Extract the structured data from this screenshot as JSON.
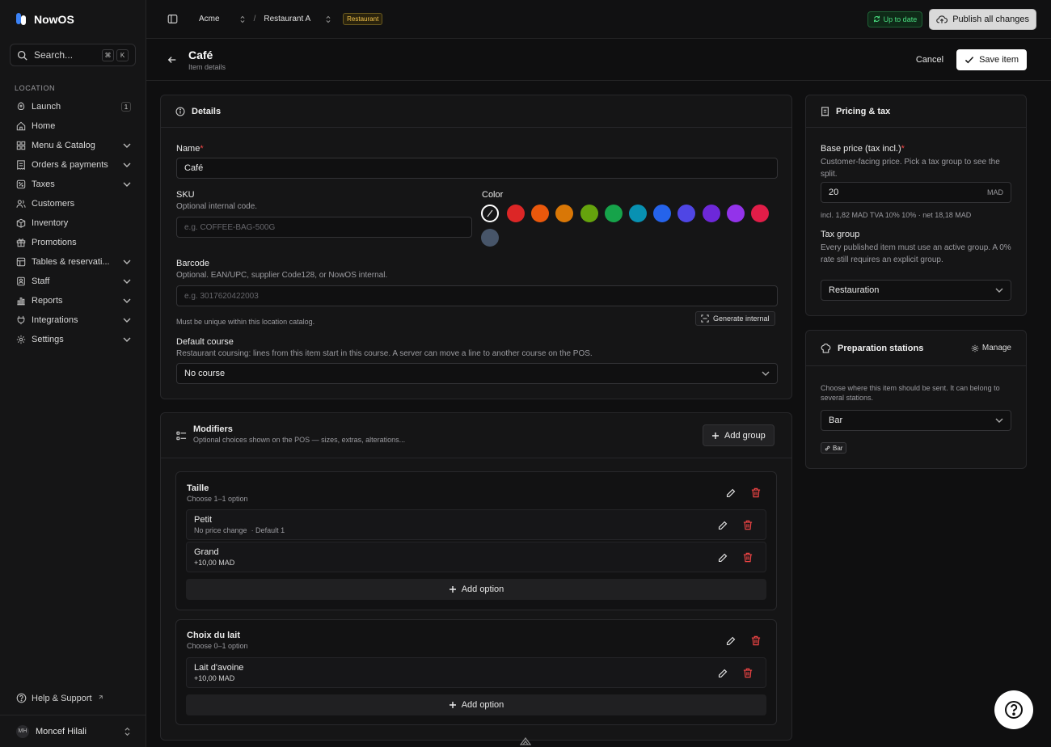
{
  "brand": {
    "name": "NowOS"
  },
  "search": {
    "placeholder": "Search...",
    "kbd1": "⌘",
    "kbd2": "K"
  },
  "sidebar": {
    "section": "LOCATION",
    "items": [
      {
        "label": "Launch",
        "count": "1",
        "icon": "rocket-icon"
      },
      {
        "label": "Home",
        "icon": "home-icon"
      },
      {
        "label": "Menu & Catalog",
        "icon": "grid-icon",
        "expand": true
      },
      {
        "label": "Orders & payments",
        "icon": "receipt-icon",
        "expand": true
      },
      {
        "label": "Taxes",
        "icon": "percent-icon",
        "expand": true
      },
      {
        "label": "Customers",
        "icon": "users-icon"
      },
      {
        "label": "Inventory",
        "icon": "box-icon"
      },
      {
        "label": "Promotions",
        "icon": "gift-icon"
      },
      {
        "label": "Tables & reservati...",
        "icon": "table-icon",
        "expand": true
      },
      {
        "label": "Staff",
        "icon": "staff-icon",
        "expand": true
      },
      {
        "label": "Reports",
        "icon": "chart-icon",
        "expand": true
      },
      {
        "label": "Integrations",
        "icon": "plug-icon",
        "expand": true
      },
      {
        "label": "Settings",
        "icon": "gear-icon",
        "expand": true
      }
    ],
    "help": "Help & Support",
    "user": {
      "initials": "MH",
      "name": "Moncef Hilali"
    }
  },
  "topbar": {
    "org": "Acme",
    "location": "Restaurant A",
    "tag": "Restaurant",
    "status": "Up to date",
    "publish": "Publish all changes"
  },
  "page": {
    "title": "Café",
    "subtitle": "Item details",
    "cancel": "Cancel",
    "save": "Save item"
  },
  "details": {
    "title": "Details",
    "name_label": "Name",
    "name_value": "Café",
    "sku_label": "SKU",
    "sku_help": "Optional internal code.",
    "sku_placeholder": "e.g. COFFEE-BAG-500G",
    "color_label": "Color",
    "colors": [
      "#dc2626",
      "#ea580c",
      "#d97706",
      "#65a30d",
      "#16a34a",
      "#0891b2",
      "#2563eb",
      "#4f46e5",
      "#6d28d9",
      "#9333ea",
      "#e11d48",
      "#475569"
    ],
    "barcode_label": "Barcode",
    "barcode_help": "Optional. EAN/UPC, supplier Code128, or NowOS internal.",
    "barcode_placeholder": "e.g. 3017620422003",
    "barcode_note": "Must be unique within this location catalog.",
    "generate": "Generate internal",
    "course_label": "Default course",
    "course_help": "Restaurant coursing: lines from this item start in this course. A server can move a line to another course on the POS.",
    "course_value": "No course"
  },
  "modifiers": {
    "title": "Modifiers",
    "subtitle": "Optional choices shown on the POS — sizes, extras, alterations...",
    "add_group": "Add group",
    "groups": [
      {
        "name": "Taille",
        "rule": "Choose 1–1 option",
        "options": [
          {
            "name": "Petit",
            "meta": "No price change",
            "meta2": "· Default 1"
          },
          {
            "name": "Grand",
            "meta": "+10,00 MAD"
          }
        ],
        "add": "Add option"
      },
      {
        "name": "Choix du lait",
        "rule": "Choose 0–1 option",
        "options": [
          {
            "name": "Lait d'avoine",
            "meta": "+10,00 MAD"
          }
        ],
        "add": "Add option"
      }
    ]
  },
  "pricing": {
    "title": "Pricing & tax",
    "base_label": "Base price (tax incl.)",
    "base_help": "Customer-facing price. Pick a tax group to see the split.",
    "base_value": "20",
    "currency": "MAD",
    "split": "incl. 1,82 MAD TVA 10% 10% · net 18,18 MAD",
    "tax_label": "Tax group",
    "tax_help": "Every published item must use an active group. A 0% rate still requires an explicit group.",
    "tax_value": "Restauration"
  },
  "stations": {
    "title": "Preparation stations",
    "manage": "Manage",
    "help": "Choose where this item should be sent. It can belong to several stations.",
    "value": "Bar",
    "chip": "Bar"
  }
}
